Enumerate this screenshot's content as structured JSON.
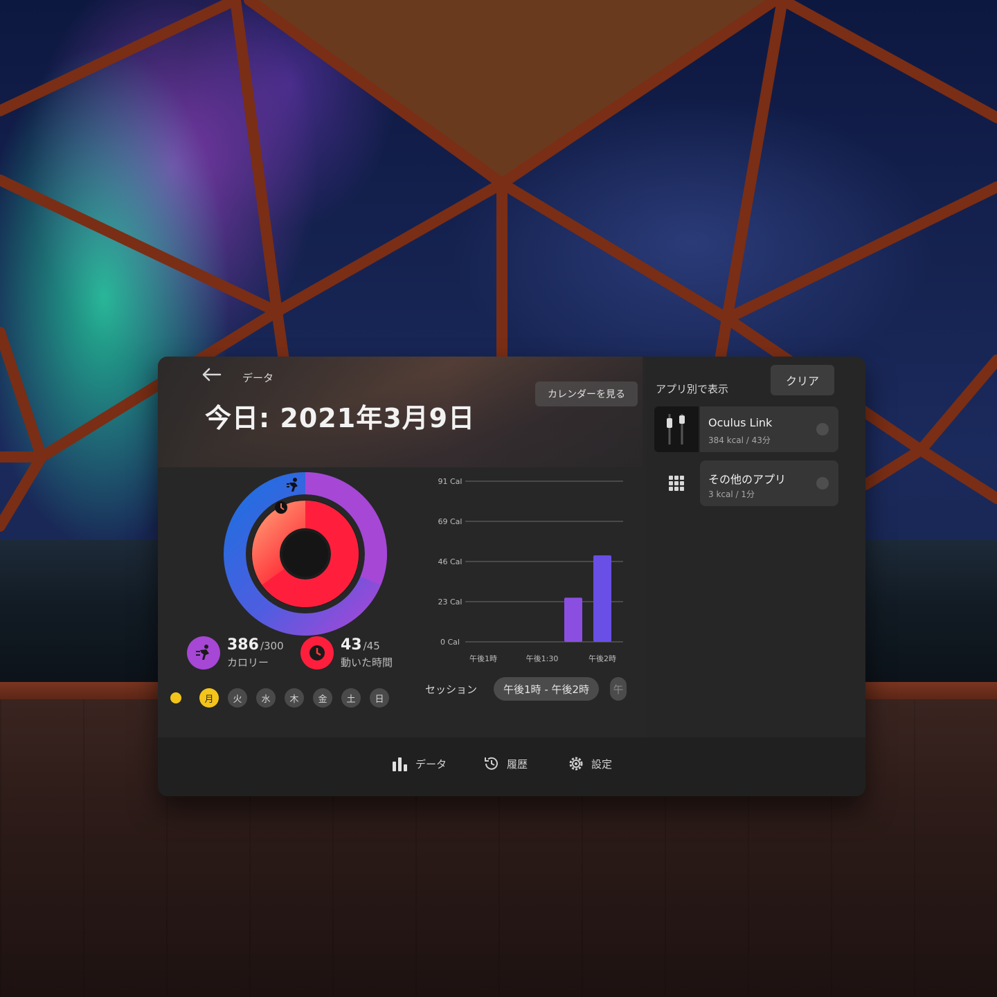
{
  "header": {
    "breadcrumb": "データ",
    "title": "今日: 2021年3月9日",
    "calendar_button": "カレンダーを見る"
  },
  "activity": {
    "calories_value": "386",
    "calories_goal": "/300",
    "calories_label": "カロリー",
    "move_time_value": "43",
    "move_time_goal": "/45",
    "move_time_label": "動いた時間",
    "ring_colors": {
      "calories_outer": "#a647d6",
      "calories_outer_start": "#1e6fe0",
      "move_inner": "#ff1f3d",
      "move_inner_light": "#ff7b5a"
    }
  },
  "week": {
    "days": [
      "月",
      "火",
      "水",
      "木",
      "金",
      "土",
      "日"
    ],
    "selected": "月"
  },
  "chart_data": {
    "type": "bar",
    "y_tick_labels": [
      "91 Cal",
      "69 Cal",
      "46 Cal",
      "23 Cal",
      "0 Cal"
    ],
    "x_tick_labels": [
      "午後1時",
      "午後1:30",
      "午後2時"
    ],
    "ylim": [
      0,
      91
    ],
    "bars": [
      {
        "x": "午後1:55",
        "value": 25
      },
      {
        "x": "午後2時",
        "value": 49
      }
    ],
    "bar_color": "#8a4fe0"
  },
  "session": {
    "label": "セッション",
    "current": "午後1時 - 午後2時",
    "next_partial": "午"
  },
  "sidebar": {
    "title": "アプリ別で表示",
    "clear_button": "クリア",
    "apps": [
      {
        "name": "Oculus Link",
        "detail": "384 kcal / 43分",
        "icon": "link-cable-icon"
      },
      {
        "name": "その他のアプリ",
        "detail": "3 kcal / 1分",
        "icon": "grid-icon"
      }
    ]
  },
  "nav": {
    "data": "データ",
    "history": "履歴",
    "settings": "設定"
  }
}
